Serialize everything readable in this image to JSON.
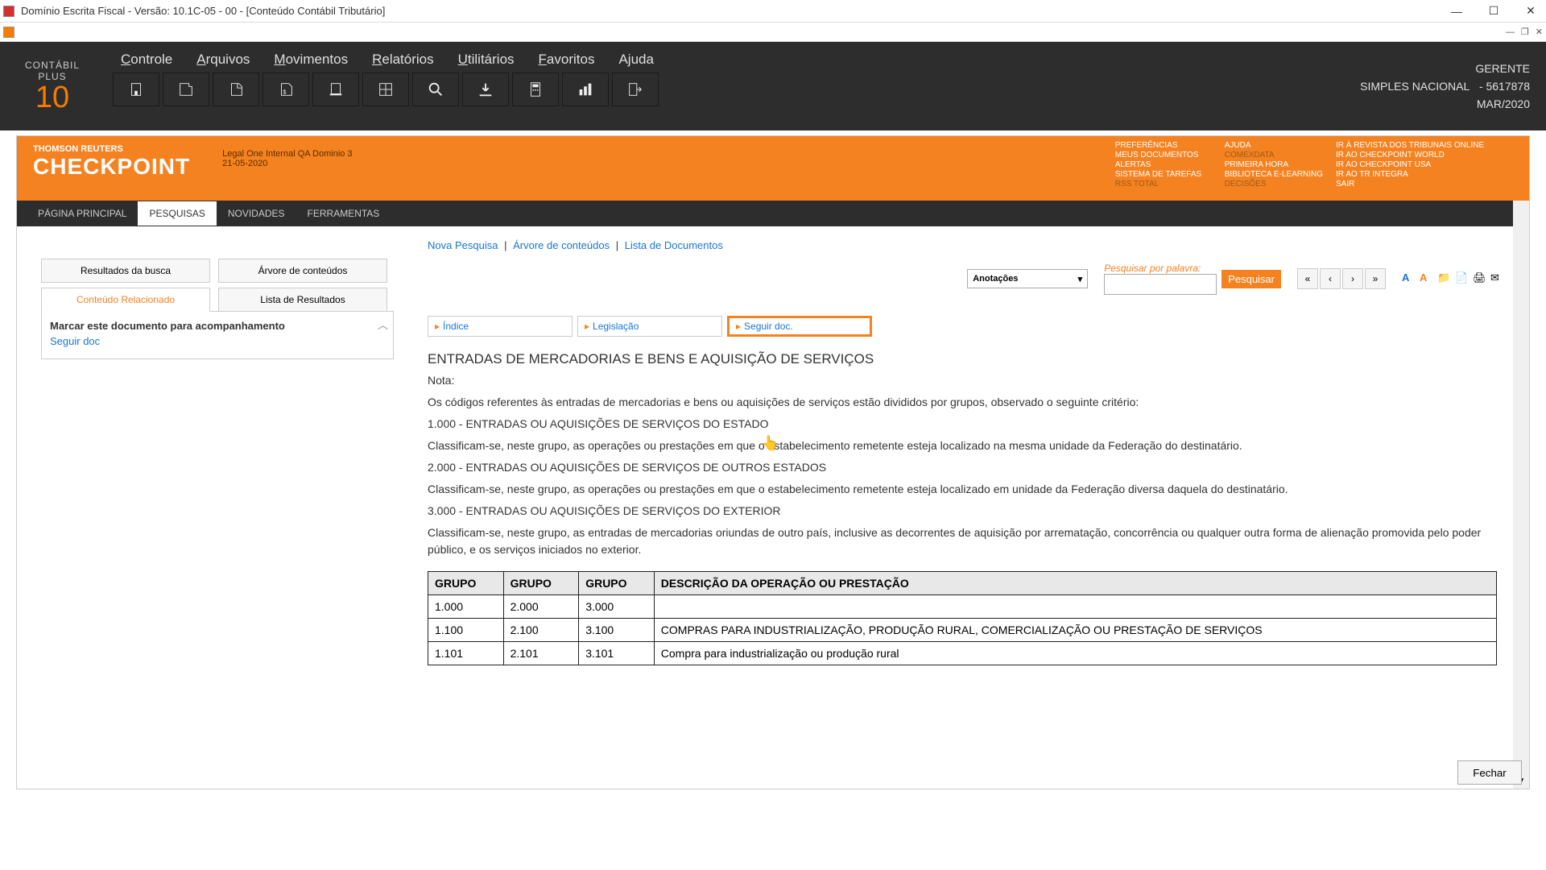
{
  "window": {
    "title": "Domínio Escrita Fiscal  - Versão: 10.1C-05 - 00 - [Conteúdo Contábil Tributário]"
  },
  "brand": {
    "line1": "CONTÁBIL",
    "line2": "PLUS",
    "num": "10"
  },
  "menu": {
    "controle": "Controle",
    "arquivos": "Arquivos",
    "movimentos": "Movimentos",
    "relatorios": "Relatórios",
    "utilitarios": "Utilitários",
    "favoritos": "Favoritos",
    "ajuda": "Ajuda"
  },
  "rightinfo": {
    "user": "GERENTE",
    "regime": "SIMPLES NACIONAL",
    "empresa": "- 5617878",
    "periodo": "MAR/2020"
  },
  "checkpoint": {
    "brand1": "THOMSON REUTERS",
    "brand2": "CHECKPOINT",
    "meta1": "Legal One Internal QA Dominio 3",
    "meta2": "21-05-2020",
    "cols": {
      "c1": [
        "PREFERÊNCIAS",
        "MEUS DOCUMENTOS",
        "ALERTAS",
        "SISTEMA DE TAREFAS",
        "RSS TOTAL"
      ],
      "c2": [
        "AJUDA",
        "COMEXDATA",
        "PRIMEIRA HORA",
        "BIBLIOTECA E-LEARNING",
        "DECISÕES"
      ],
      "c3": [
        "IR À REVISTA DOS TRIBUNAIS ONLINE",
        "IR AO CHECKPOINT WORLD",
        "IR AO CHECKPOINT USA",
        "IR AO TR INTEGRA",
        "SAIR"
      ]
    },
    "tabs": {
      "principal": "PÁGINA PRINCIPAL",
      "pesquisas": "PESQUISAS",
      "novidades": "NOVIDADES",
      "ferramentas": "FERRAMENTAS"
    }
  },
  "sidebar": {
    "resultados_busca": "Resultados da busca",
    "arvore": "Árvore de conteúdos",
    "conteudo_rel": "Conteúdo Relacionado",
    "lista_result": "Lista de Resultados",
    "panel_title": "Marcar este documento para acompanhamento",
    "seguir": "Seguir doc"
  },
  "main": {
    "breadcrumb": {
      "nova": "Nova Pesquisa",
      "arvore": "Árvore de conteúdos",
      "lista": "Lista de Documentos"
    },
    "combo": "Anotações",
    "search_label": "Pesquisar por palavra:",
    "search_btn": "Pesquisar",
    "docnav": {
      "indice": "Índice",
      "legislacao": "Legislação",
      "seguir": "Seguir doc."
    }
  },
  "document": {
    "title": "ENTRADAS DE MERCADORIAS E BENS E AQUISIÇÃO DE SERVIÇOS",
    "nota": "Nota:",
    "p1": "Os códigos referentes às entradas de mercadorias e bens ou aquisições de serviços estão divididos por grupos, observado o seguinte critério:",
    "g1": "1.000 - ENTRADAS OU AQUISIÇÕES DE SERVIÇOS DO ESTADO",
    "g1d": "Classificam-se, neste grupo, as operações ou prestações em que o estabelecimento remetente esteja localizado na mesma unidade da Federação do destinatário.",
    "g2": "2.000 - ENTRADAS OU AQUISIÇÕES DE SERVIÇOS DE OUTROS ESTADOS",
    "g2d": "Classificam-se, neste grupo, as operações ou prestações em que o estabelecimento remetente esteja localizado em unidade da Federação diversa daquela do destinatário.",
    "g3": "3.000 - ENTRADAS OU AQUISIÇÕES DE SERVIÇOS DO EXTERIOR",
    "g3d": "Classificam-se, neste grupo, as entradas de mercadorias oriundas de outro país, inclusive as decorrentes de aquisição por arrematação, concorrência ou qualquer outra forma de alienação promovida pelo poder público, e os serviços iniciados no exterior.",
    "table": {
      "headers": [
        "GRUPO",
        "GRUPO",
        "GRUPO",
        "DESCRIÇÃO DA OPERAÇÃO OU PRESTAÇÃO"
      ],
      "rows": [
        [
          "1.000",
          "2.000",
          "3.000",
          ""
        ],
        [
          "1.100",
          "2.100",
          "3.100",
          "COMPRAS PARA INDUSTRIALIZAÇÃO, PRODUÇÃO RURAL, COMERCIALIZAÇÃO OU PRESTAÇÃO DE SERVIÇOS"
        ],
        [
          "1.101",
          "2.101",
          "3.101",
          "Compra para industrialização ou produção rural"
        ]
      ]
    }
  },
  "footer": {
    "fechar": "Fechar"
  }
}
